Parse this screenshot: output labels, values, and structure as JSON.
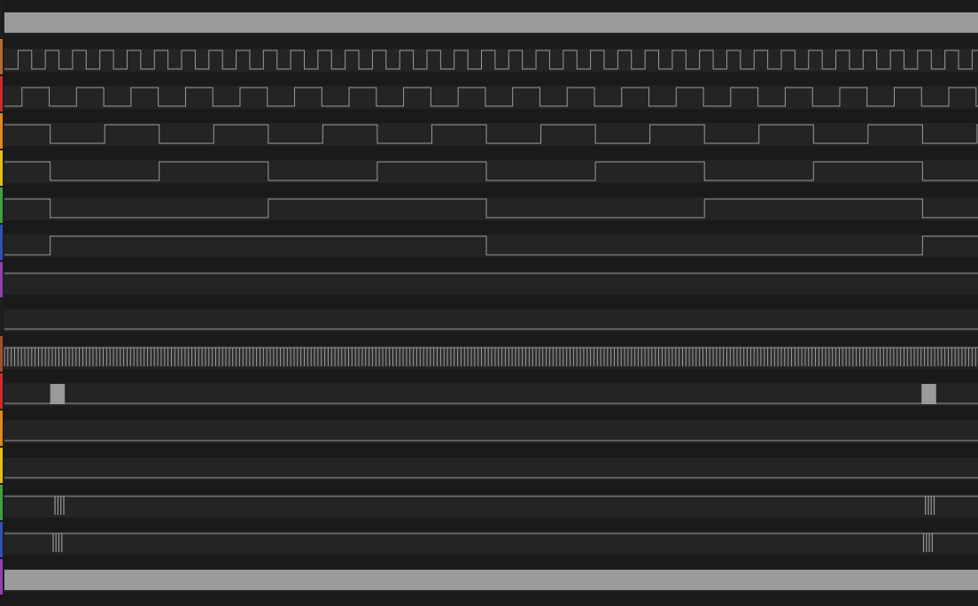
{
  "colors": {
    "background": "#1a1a1a",
    "row_background": "#242424",
    "trace": "#9a9a9a",
    "bus_fill": "#9a9a9a"
  },
  "timeline": {
    "start": 0,
    "end": 1
  },
  "channels": [
    {
      "id": "ch0",
      "color": "#1e1e1e",
      "type": "bus",
      "segments": [
        [
          0,
          1
        ]
      ]
    },
    {
      "id": "ch1",
      "color": "#b86a2c",
      "type": "clock",
      "period": 0.028,
      "phase": 0.0,
      "start_low": true
    },
    {
      "id": "ch2",
      "color": "#d02a2a",
      "type": "clock",
      "period": 0.056,
      "phase": 0.018,
      "start_low": true
    },
    {
      "id": "ch3",
      "color": "#e08a1a",
      "type": "clock",
      "period": 0.112,
      "phase": 0.047,
      "start_low": false
    },
    {
      "id": "ch4",
      "color": "#e0c020",
      "type": "clock",
      "period": 0.224,
      "phase": 0.047,
      "start_low": false
    },
    {
      "id": "ch5",
      "color": "#40a040",
      "type": "clock",
      "period": 0.448,
      "phase": 0.047,
      "start_low": false
    },
    {
      "id": "ch6",
      "color": "#3050c0",
      "type": "clock",
      "period": 0.896,
      "phase": 0.047,
      "start_low": true
    },
    {
      "id": "ch7",
      "color": "#9040b0",
      "type": "flat",
      "level": "high"
    },
    {
      "id": "ch8",
      "color": "#1e1e1e",
      "type": "flat",
      "level": "low"
    },
    {
      "id": "ch9",
      "color": "#a05030",
      "type": "dense",
      "period": 0.0035
    },
    {
      "id": "ch10",
      "color": "#d02a2a",
      "type": "bus",
      "segments": [
        [
          0.047,
          0.062
        ],
        [
          0.942,
          0.957
        ]
      ],
      "baseline": true
    },
    {
      "id": "ch11",
      "color": "#e08a1a",
      "type": "flat",
      "level": "low"
    },
    {
      "id": "ch12",
      "color": "#e0c020",
      "type": "flat",
      "level": "low"
    },
    {
      "id": "ch13",
      "color": "#40a040",
      "type": "burst",
      "level": "high",
      "bursts": [
        0.052,
        0.946
      ],
      "count": 4,
      "spacing": 0.003
    },
    {
      "id": "ch14",
      "color": "#3050c0",
      "type": "burst",
      "level": "high",
      "bursts": [
        0.05,
        0.944
      ],
      "count": 4,
      "spacing": 0.003
    },
    {
      "id": "ch15",
      "color": "#9040b0",
      "type": "bus",
      "segments": [
        [
          0,
          1
        ]
      ]
    }
  ]
}
